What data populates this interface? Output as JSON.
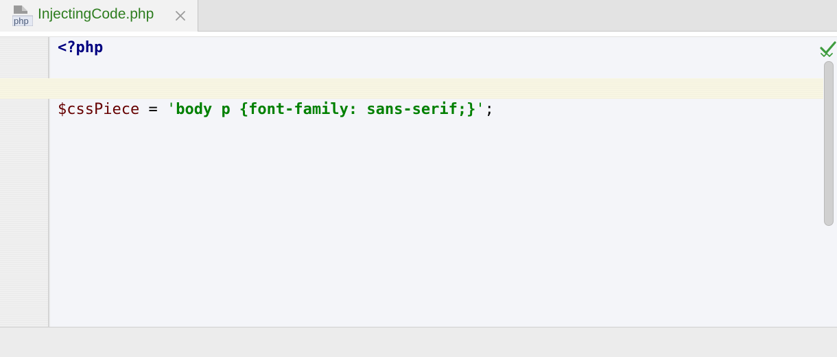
{
  "tab": {
    "filename": "InjectingCode.php",
    "icon_label": "php",
    "icon": "php-file-icon",
    "close_icon": "close-icon",
    "label_color": "#2e7d1f"
  },
  "editor": {
    "lines": [
      {
        "open_tag": "<?php"
      },
      {},
      {
        "variable": "$cssPiece",
        "operator": " = ",
        "quote_open": "'",
        "string_body": "body p {font-family: sans-serif;}",
        "quote_close": "'",
        "terminator": ";"
      }
    ],
    "inspection_status": "check-icon",
    "colors": {
      "keyword": "#000080",
      "variable": "#660000",
      "string": "#008000",
      "caret_row": "#f8f6e3"
    }
  }
}
